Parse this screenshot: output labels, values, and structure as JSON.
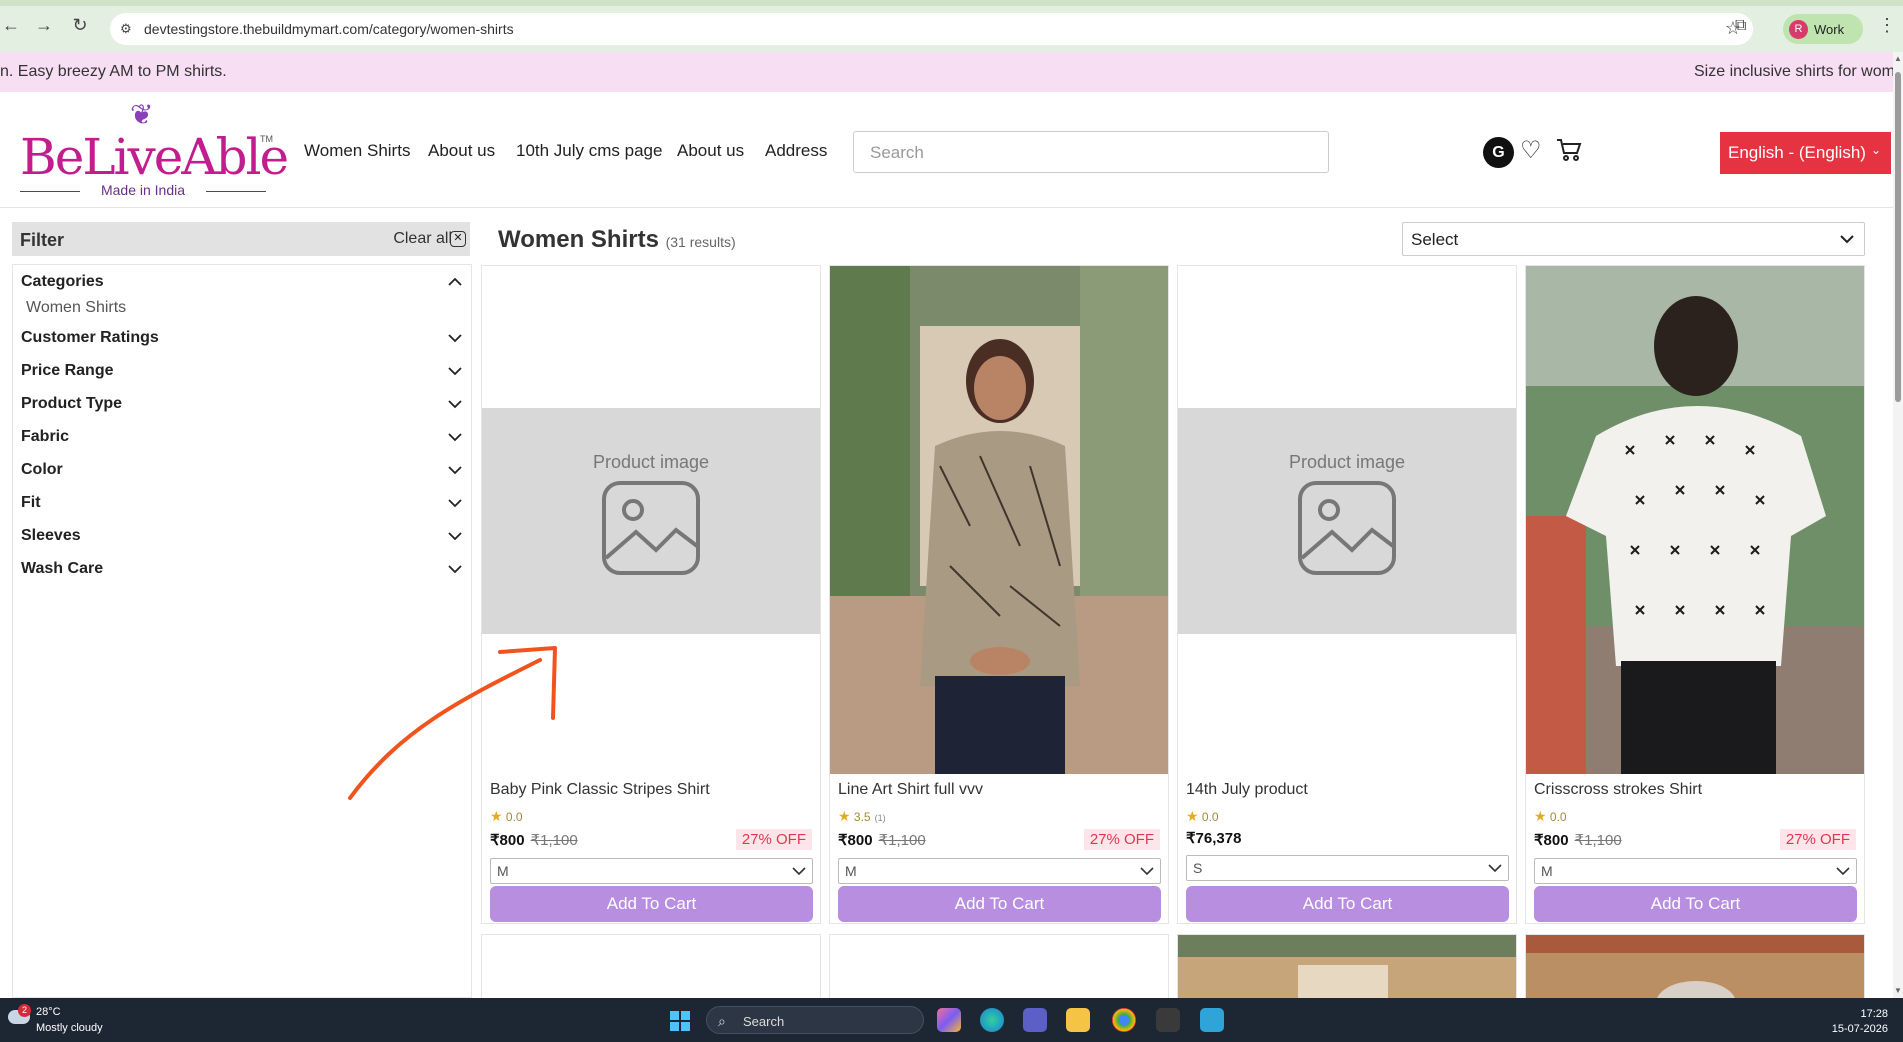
{
  "browser": {
    "url": "devtestingstore.thebuildmymart.com/category/women-shirts",
    "profile_initial": "R",
    "profile_label": "Work"
  },
  "marquee": {
    "left_text": "n. Easy breezy AM to PM shirts.",
    "right_text": "Size inclusive shirts for wom"
  },
  "header": {
    "logo_word": "BeLiveAble",
    "logo_tm": "TM",
    "logo_tagline": "Made in India",
    "nav": [
      "Women Shirts",
      "About us",
      "10th July cms page",
      "About us",
      "Address"
    ],
    "search_placeholder": "Search",
    "account_initial": "G",
    "language": "English - (English)"
  },
  "filter": {
    "title": "Filter",
    "clear_all": "Clear all",
    "categories_label": "Categories",
    "categories_value": "Women Shirts",
    "facets": [
      "Customer Ratings",
      "Price Range",
      "Product Type",
      "Fabric",
      "Color",
      "Fit",
      "Sleeves",
      "Wash Care"
    ]
  },
  "listing": {
    "title": "Women Shirts",
    "results": "(31 results)",
    "sort_value": "Select",
    "placeholder_text": "Product image",
    "add_to_cart": "Add To Cart",
    "products": [
      {
        "name": "Baby Pink Classic Stripes Shirt",
        "rating": "0.0",
        "rating_count": "",
        "price": "₹800",
        "mrp": "₹1,100",
        "off": "27% OFF",
        "size": "M",
        "image": "placeholder"
      },
      {
        "name": "Line Art Shirt full vvv",
        "rating": "3.5",
        "rating_count": "(1)",
        "price": "₹800",
        "mrp": "₹1,100",
        "off": "27% OFF",
        "size": "M",
        "image": "photo"
      },
      {
        "name": "14th July product",
        "rating": "0.0",
        "rating_count": "",
        "price": "₹76,378",
        "mrp": "",
        "off": "",
        "size": "S",
        "image": "placeholder"
      },
      {
        "name": "Crisscross strokes Shirt",
        "rating": "0.0",
        "rating_count": "",
        "price": "₹800",
        "mrp": "₹1,100",
        "off": "27% OFF",
        "size": "M",
        "image": "photo"
      }
    ]
  },
  "taskbar": {
    "notification_count": "2",
    "temperature": "28°C",
    "weather": "Mostly cloudy",
    "search_label": "Search",
    "time": "17:28",
    "date": "15-07-2026"
  },
  "colors": {
    "brand_pink": "#c21d8e",
    "add_to_cart": "#b88ee0",
    "language_button": "#e63342",
    "marquee_bg": "#f7def3",
    "discount_text": "#e2364f",
    "annotation_arrow": "#f0541c"
  }
}
